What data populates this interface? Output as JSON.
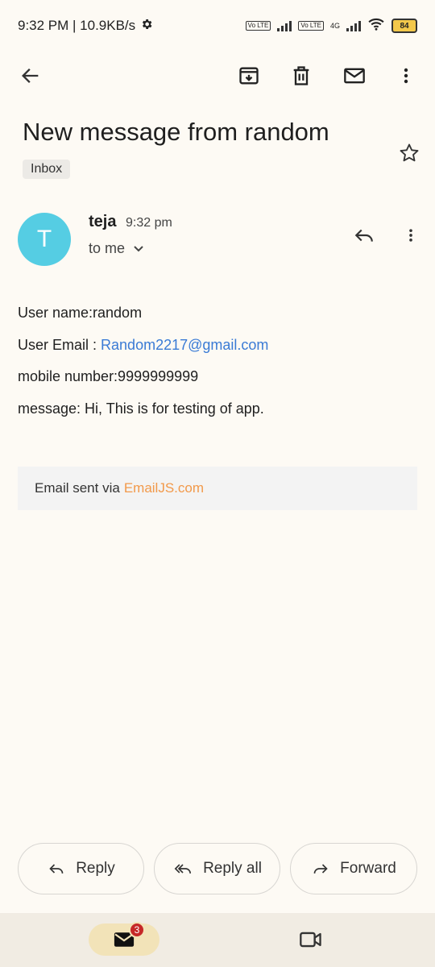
{
  "status": {
    "time_speed": "9:32 PM | 10.9KB/s",
    "volte1": "Vo LTE",
    "volte2": "Vo LTE",
    "network": "4G",
    "battery": "84"
  },
  "toolbar": {
    "icons": [
      "back-arrow-icon",
      "archive-icon",
      "delete-icon",
      "mark-unread-icon",
      "more-vert-icon"
    ]
  },
  "email": {
    "subject": "New message from random",
    "label": "Inbox",
    "sender_initial": "T",
    "sender": "teja",
    "time": "9:32 pm",
    "recipient": "to me",
    "body": {
      "line1": "User name:random",
      "line2_prefix": "User Email : ",
      "line2_link": "Random2217@gmail.com",
      "line3": "mobile number:9999999999",
      "line4": "message: Hi, This is for testing of app."
    },
    "footer_prefix": "Email sent via",
    "footer_link": "EmailJS.com"
  },
  "actions": {
    "reply": "Reply",
    "reply_all": "Reply all",
    "forward": "Forward"
  },
  "bottom_nav": {
    "mail_badge": "3"
  },
  "colors": {
    "background": "#fdfaf4",
    "avatar": "#55cde3",
    "link": "#3a7bd5",
    "footer_link": "#f2994a",
    "badge": "#c62828",
    "mail_tab": "#f2e3b8"
  }
}
